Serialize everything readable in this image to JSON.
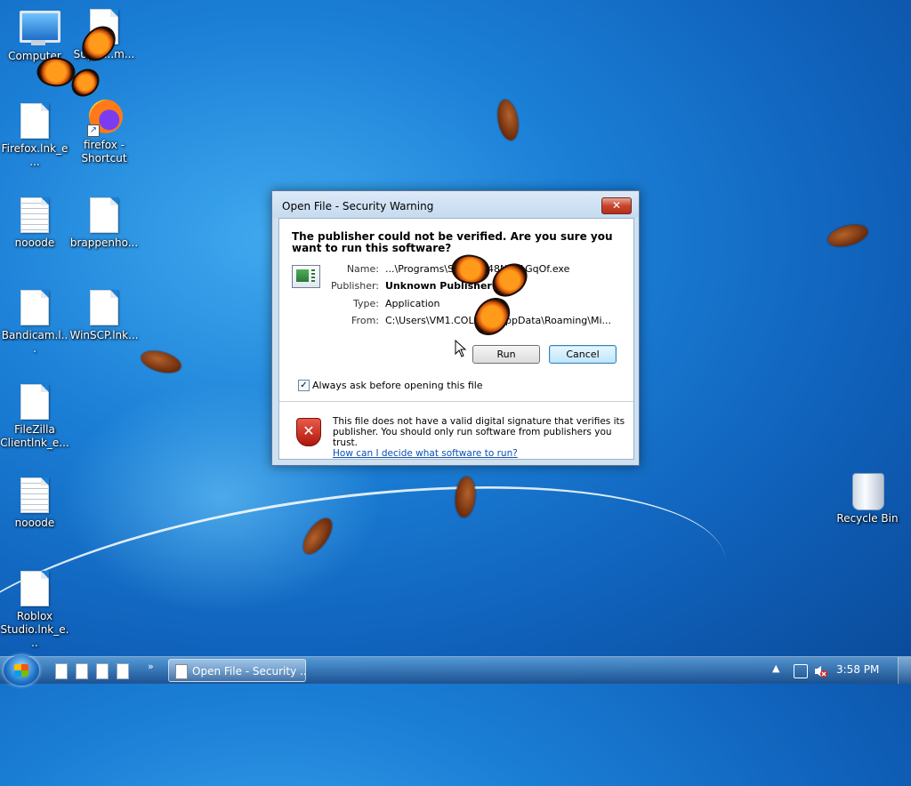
{
  "desktop": {
    "icons": [
      {
        "label": "Computer"
      },
      {
        "label": "Super...m..."
      },
      {
        "label": "Firefox.lnk_e..."
      },
      {
        "label": "firefox - Shortcut"
      },
      {
        "label": "nooode"
      },
      {
        "label": "brappenho..."
      },
      {
        "label": "Bandicam.l..."
      },
      {
        "label": "WinSCP.lnk..."
      },
      {
        "label": "FileZilla Clientlnk_e..."
      },
      {
        "label": "nooode"
      },
      {
        "label": "Roblox Studio.lnk_e..."
      },
      {
        "label": "Recycle Bin"
      }
    ]
  },
  "dialog": {
    "title": "Open File - Security Warning",
    "close_label": "✕",
    "headline": "The publisher could not be verified.  Are you sure you want to run this software?",
    "rows": [
      {
        "key": "Name:",
        "value": "...\\Programs\\St...URZ48NsaAGqOf.exe"
      },
      {
        "key": "Publisher:",
        "value": "Unknown Publisher"
      },
      {
        "key": "Type:",
        "value": "Application"
      },
      {
        "key": "From:",
        "value": "C:\\Users\\VM1.COLLA...\\AppData\\Roaming\\Mi..."
      }
    ],
    "run_label": "Run",
    "cancel_label": "Cancel",
    "checkbox_label": "Always ask before opening this file",
    "checkbox_checked": true,
    "warning_text": "This file does not have a valid digital signature that verifies its publisher.  You should only run software from publishers you trust.",
    "warning_link": "How can I decide what software to run?"
  },
  "taskbar": {
    "chevron": "»",
    "task_label": "Open File - Security ...",
    "tray_arrow": "▲",
    "clock": "3:58 PM"
  }
}
